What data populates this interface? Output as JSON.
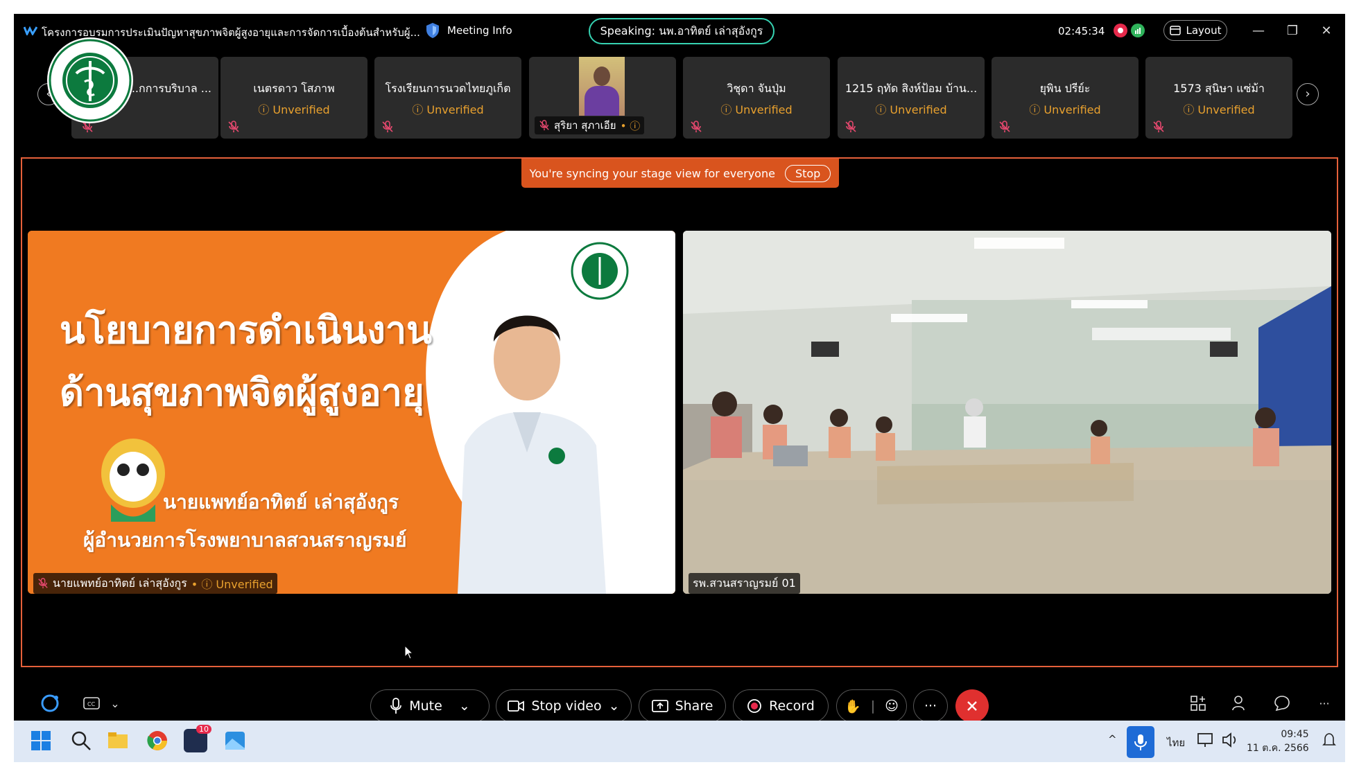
{
  "titlebar": {
    "meeting_title": "โครงการอบรมการประเมินปัญหาสุขภาพจิตผู้สูงอายุและการจัดการเบื้องต้นสำหรับผู้...",
    "meeting_info": "Meeting Info",
    "speaking": "Speaking: นพ.อาทิตย์ เล่าสุอังกูร",
    "timer": "02:45:34",
    "layout_label": "Layout",
    "colors": {
      "speaking_border": "#36d3b2",
      "recording": "#e6294b"
    }
  },
  "participants": [
    {
      "name": "...กการบริบาล ...",
      "status": ""
    },
    {
      "name": "เนตรดาว โสภาพ",
      "status": "Unverified"
    },
    {
      "name": "โรงเรียนการนวดไทยภูเก็ต",
      "status": "Unverified"
    },
    {
      "name": "สุริยา สุภาเอีย",
      "status": "",
      "has_video": true
    },
    {
      "name": "วิชุดา จันปุ่ม",
      "status": "Unverified"
    },
    {
      "name": "1215 ฤทัด สิงห์ป้อม บ้าน...",
      "status": "Unverified"
    },
    {
      "name": "ยุพิน ปรีย์ะ",
      "status": "Unverified"
    },
    {
      "name": "1573 สุนิษา แซ่ม้า",
      "status": "Unverified"
    }
  ],
  "stage": {
    "sync_text": "You're syncing your stage view for everyone",
    "stop_label": "Stop",
    "left_tile": {
      "slide_line1": "นโยบายการดำเนินงาน",
      "slide_line2": "ด้านสุขภาพจิตผู้สูงอายุ",
      "slide_name": "นายแพทย์อาทิตย์  เล่าสุอังกูร",
      "slide_position": "ผู้อำนวยการโรงพยาบาลสวนสราญรมย์",
      "label_name": "นายแพทย์อาทิตย์ เล่าสุอังกูร",
      "label_status": "Unverified"
    },
    "right_tile": {
      "label_name": "รพ.สวนสราญรมย์ 01"
    }
  },
  "controls": {
    "mute": "Mute",
    "stop_video": "Stop video",
    "share": "Share",
    "record": "Record"
  },
  "taskbar": {
    "teams_badge": "10",
    "language": "ไทย",
    "time": "09:45",
    "date": "11 ต.ค. 2566"
  }
}
